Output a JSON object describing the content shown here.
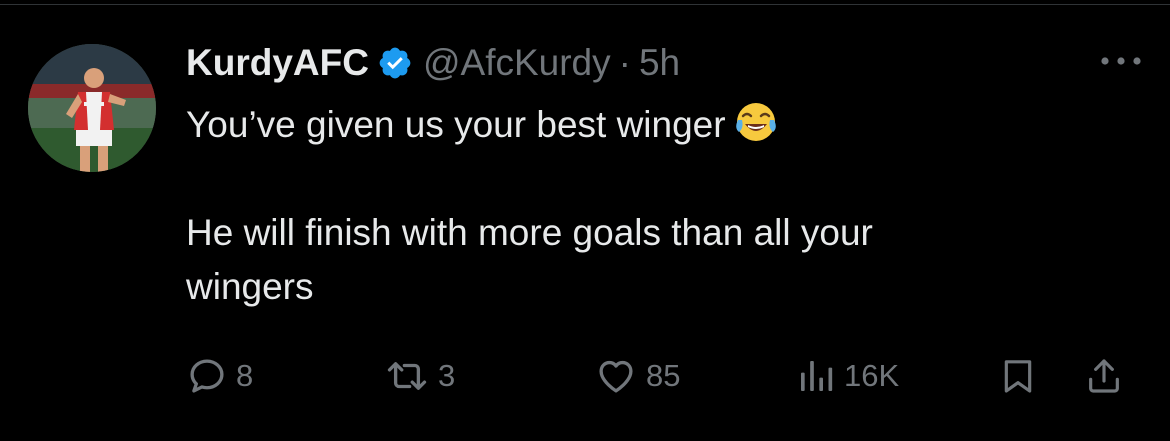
{
  "tweet": {
    "display_name": "KurdyAFC",
    "handle": "@AfcKurdy",
    "separator": "·",
    "time": "5h",
    "text_lines": [
      "You’ve given us your best winger",
      "",
      "He will finish with more goals than all your",
      "wingers"
    ],
    "emoji": "face-with-tears-of-joy-icon"
  },
  "actions": {
    "replies": "8",
    "retweets": "3",
    "likes": "85",
    "views": "16K"
  },
  "colors": {
    "background": "#000000",
    "text_primary": "#e7e9ea",
    "text_secondary": "#71767b",
    "verified_badge": "#1d9bf0",
    "divider": "#2f3336"
  }
}
